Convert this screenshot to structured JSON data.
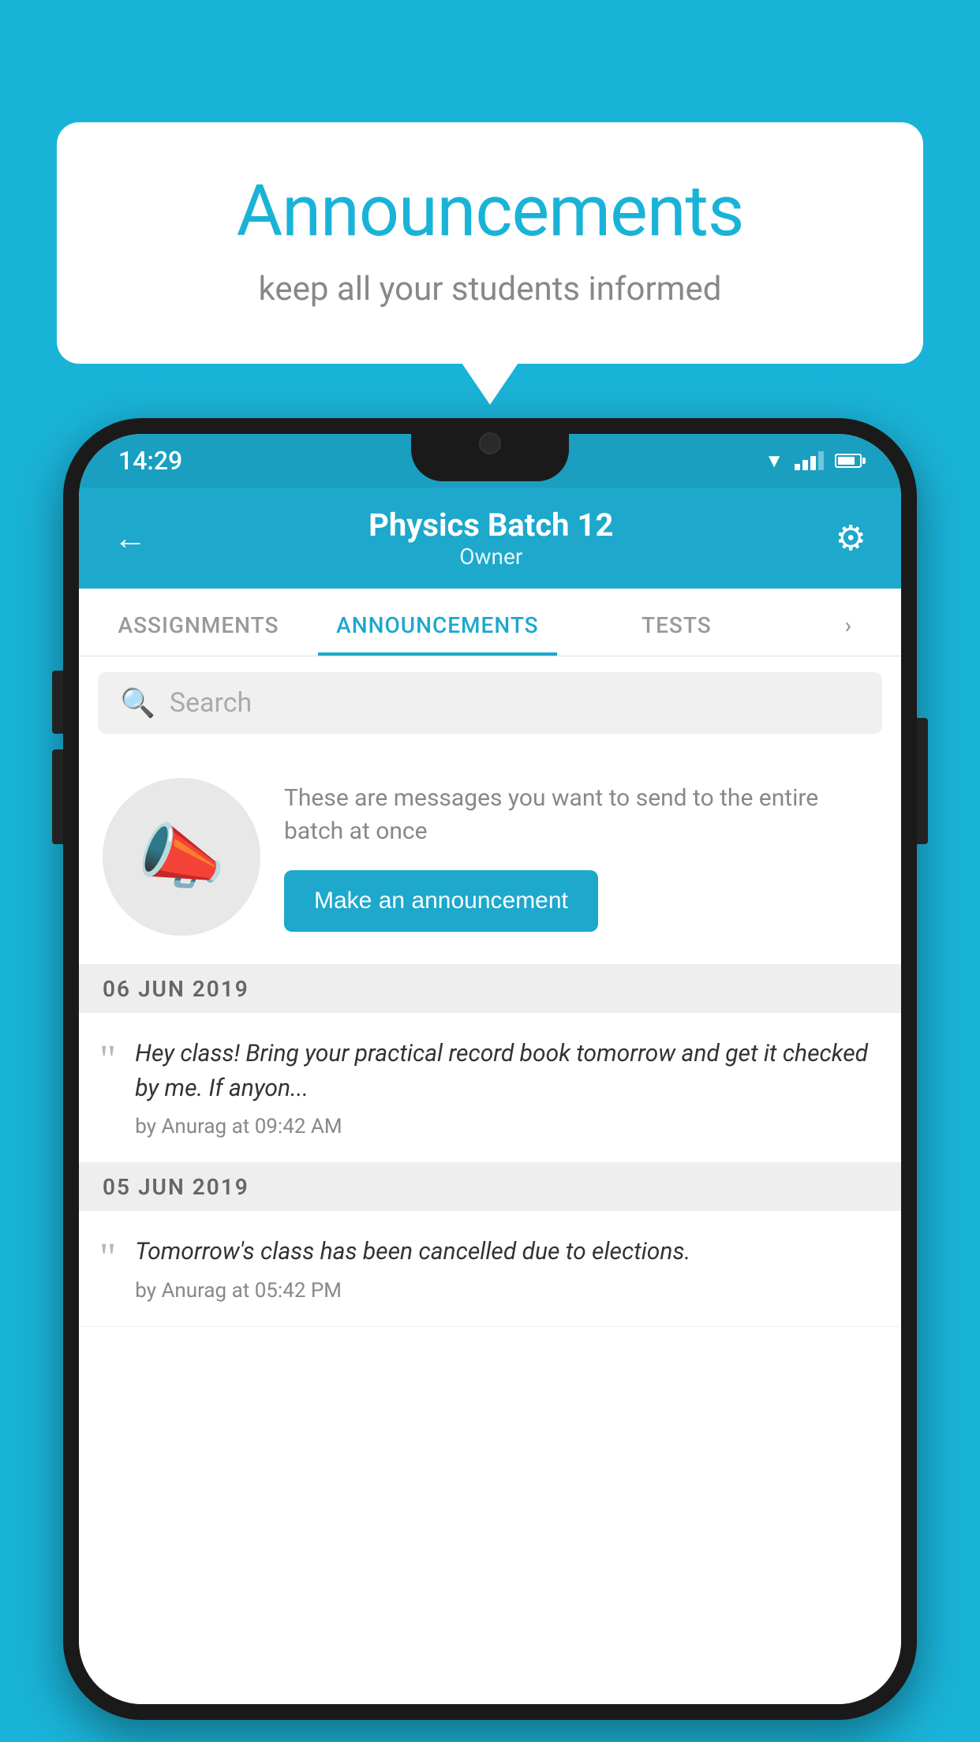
{
  "background_color": "#1ab3d8",
  "speech_bubble": {
    "title": "Announcements",
    "subtitle": "keep all your students informed"
  },
  "status_bar": {
    "time": "14:29"
  },
  "app_header": {
    "title": "Physics Batch 12",
    "subtitle": "Owner",
    "back_label": "←",
    "gear_label": "⚙"
  },
  "tabs": [
    {
      "label": "ASSIGNMENTS",
      "active": false
    },
    {
      "label": "ANNOUNCEMENTS",
      "active": true
    },
    {
      "label": "TESTS",
      "active": false
    },
    {
      "label": "...",
      "active": false
    }
  ],
  "search": {
    "placeholder": "Search"
  },
  "promo": {
    "description": "These are messages you want to send to the entire batch at once",
    "button_label": "Make an announcement"
  },
  "date_groups": [
    {
      "date": "06  JUN  2019",
      "announcements": [
        {
          "text": "Hey class! Bring your practical record book tomorrow and get it checked by me. If anyon...",
          "meta": "by Anurag at 09:42 AM"
        }
      ]
    },
    {
      "date": "05  JUN  2019",
      "announcements": [
        {
          "text": "Tomorrow's class has been cancelled due to elections.",
          "meta": "by Anurag at 05:42 PM"
        }
      ]
    }
  ]
}
